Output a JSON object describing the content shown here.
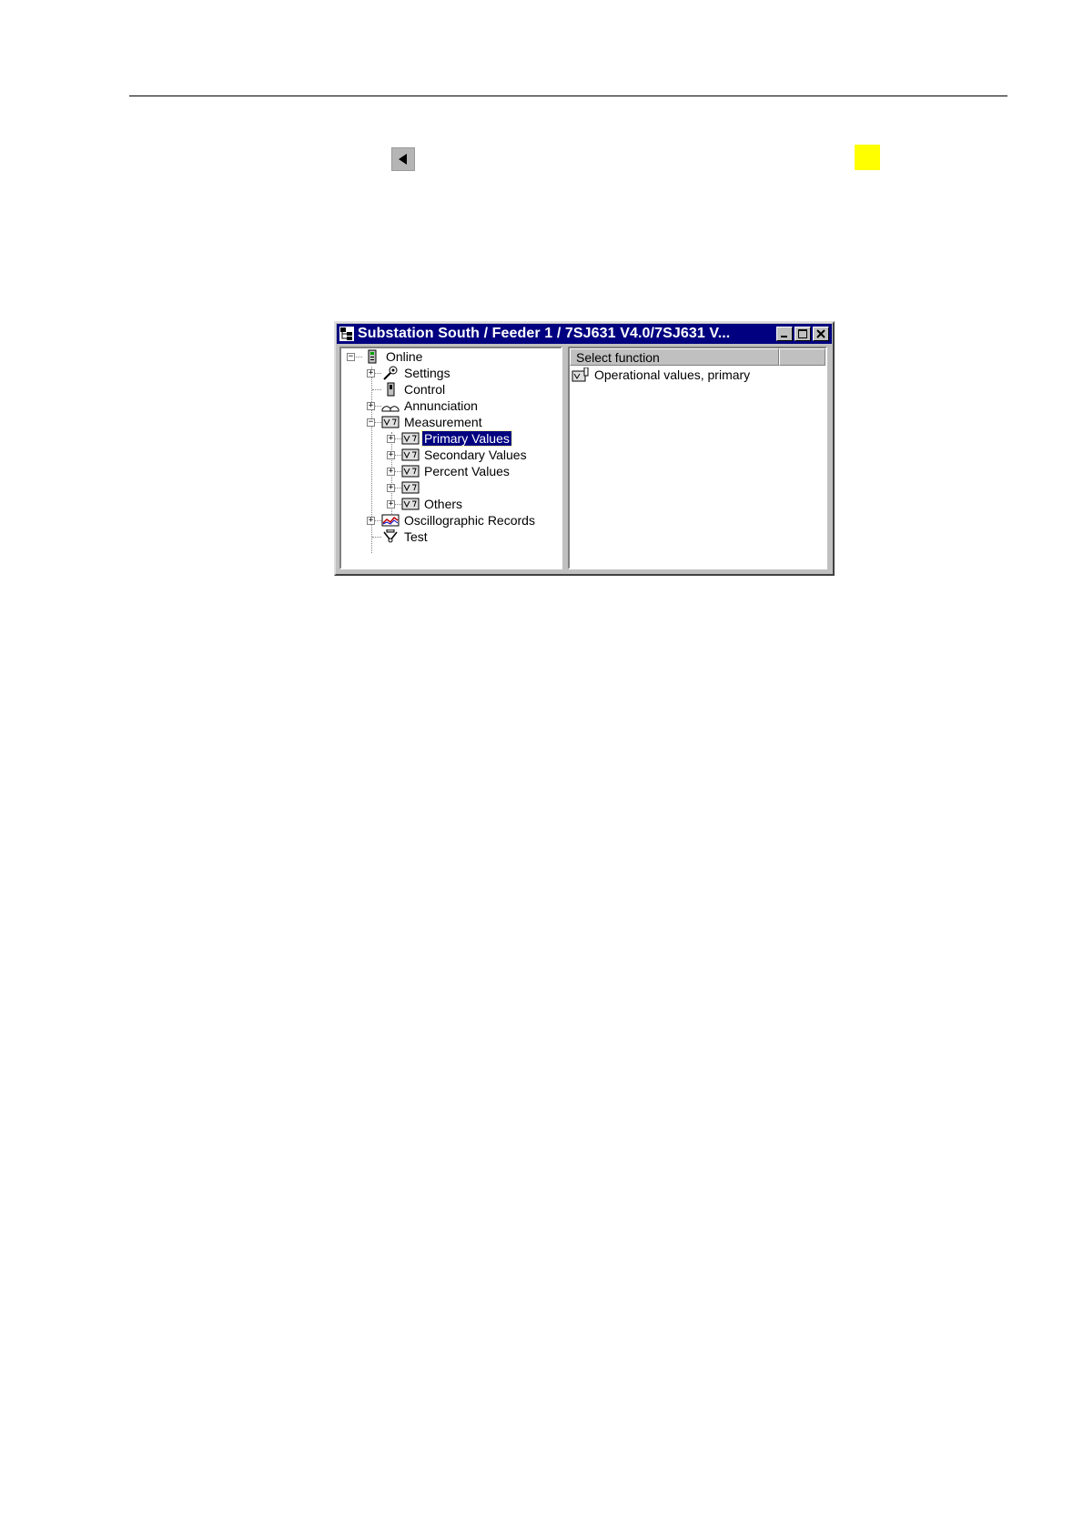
{
  "window": {
    "title": "Substation South / Feeder 1 / 7SJ631 V4.0/7SJ631 V...",
    "title_icon": "device-tree-icon",
    "controls": [
      "minimize-icon",
      "maximize-icon",
      "close-icon"
    ]
  },
  "colors": {
    "titlebar": "#000080",
    "selection": "#000080",
    "marker": "#ffff00",
    "window_face": "#c0c0c0"
  },
  "tree": {
    "online": "Online",
    "settings": "Settings",
    "control": "Control",
    "annunciation": "Annunciation",
    "measurement": "Measurement",
    "primary_values": "Primary Values",
    "secondary_values": "Secondary Values",
    "percent_values": "Percent Values",
    "unnamed": "",
    "others": "Others",
    "oscillographic_records": "Oscillographic Records",
    "test": "Test"
  },
  "list": {
    "column_header": "Select function",
    "items": [
      "Operational values, primary"
    ]
  },
  "page": {
    "back_button_icon": "triangle-left-icon"
  }
}
